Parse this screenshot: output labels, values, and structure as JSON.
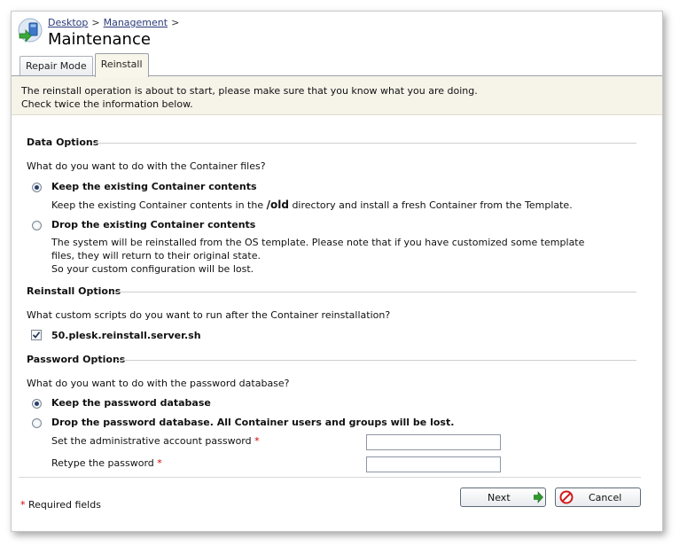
{
  "header": {
    "breadcrumb": [
      "Desktop",
      "Management"
    ],
    "breadcrumb_separator": ">",
    "title": "Maintenance",
    "tabs": [
      {
        "label": "Repair Mode",
        "active": false
      },
      {
        "label": "Reinstall",
        "active": true
      }
    ]
  },
  "notice": {
    "line1": "The reinstall operation is about to start, please make sure that you know what you are doing.",
    "line2": "Check twice the information below."
  },
  "data_options": {
    "title": "Data Options",
    "question": "What do you want to do with the Container files?",
    "keep_label": "Keep the existing Container contents",
    "keep_checked": true,
    "keep_desc_prefix": "Keep the existing Container contents in the",
    "keep_desc_path": "/old",
    "keep_desc_suffix": "directory and install a fresh Container from the Template.",
    "drop_label": "Drop the existing Container contents",
    "drop_checked": false,
    "drop_desc": [
      "The system will be reinstalled from the OS template. Please note that if you have customized some template",
      "files, they will return to their original state.",
      "So your custom configuration will be lost."
    ]
  },
  "reinstall_options": {
    "title": "Reinstall Options",
    "question": "What custom scripts do you want to run after the Container reinstallation?",
    "script_label": "50.plesk.reinstall.server.sh",
    "script_checked": true
  },
  "password_options": {
    "title": "Password Options",
    "question": "What do you want to do with the password database?",
    "keep_label": "Keep the password database",
    "keep_checked": true,
    "drop_label": "Drop the password database. All Container users and groups will be lost.",
    "drop_checked": false,
    "admin_password_label": "Set the administrative account password",
    "admin_password_value": "",
    "retype_label": "Retype the password",
    "retype_value": "",
    "required_mark": "*"
  },
  "footer": {
    "required_note": "Required fields",
    "required_mark": "*",
    "next_label": "Next",
    "cancel_label": "Cancel"
  },
  "colors": {
    "notice_bg": "#f6f3e9",
    "required": "#d20000",
    "link": "#2a3b7a",
    "next_arrow": "#2e9a2e",
    "cancel_icon": "#d21a1a"
  }
}
